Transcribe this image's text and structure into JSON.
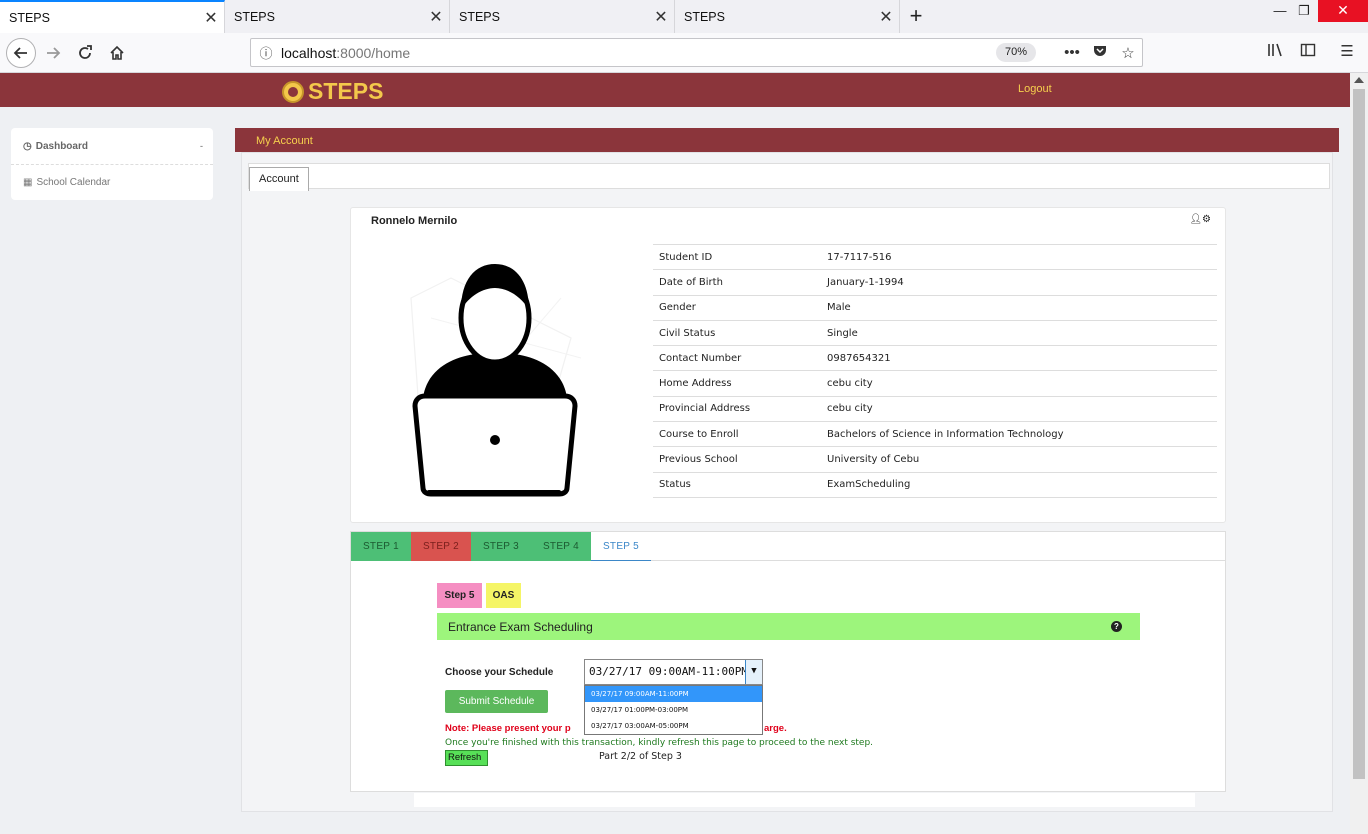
{
  "browser": {
    "tabs": [
      {
        "title": "STEPS"
      },
      {
        "title": "STEPS"
      },
      {
        "title": "STEPS"
      },
      {
        "title": "STEPS"
      }
    ],
    "url_host": "localhost",
    "url_rest": ":8000/home",
    "zoom": "70%"
  },
  "header": {
    "brand": "STEPS",
    "logout": "Logout"
  },
  "sidebar": {
    "items": [
      {
        "label": "Dashboard",
        "icon": "dashboard-icon"
      },
      {
        "label": "School Calendar",
        "icon": "calendar-icon"
      }
    ]
  },
  "account": {
    "header": "My Account",
    "tab": "Account"
  },
  "profile": {
    "name": "Ronnelo Mernilo",
    "fields": [
      {
        "label": "Student ID",
        "value": "17-7117-516"
      },
      {
        "label": "Date of Birth",
        "value": "January-1-1994"
      },
      {
        "label": "Gender",
        "value": "Male"
      },
      {
        "label": "Civil Status",
        "value": "Single"
      },
      {
        "label": "Contact Number",
        "value": "0987654321"
      },
      {
        "label": "Home Address",
        "value": "cebu city"
      },
      {
        "label": "Provincial Address",
        "value": "cebu city"
      },
      {
        "label": "Course to Enroll",
        "value": "Bachelors of Science in Information Technology"
      },
      {
        "label": "Previous School",
        "value": "University of Cebu"
      },
      {
        "label": "Status",
        "value": "ExamScheduling"
      }
    ]
  },
  "steps": {
    "tabs": [
      {
        "label": "STEP 1",
        "state": "done",
        "color": "#4dbf76"
      },
      {
        "label": "STEP 2",
        "state": "failed",
        "color": "#d9534f"
      },
      {
        "label": "STEP 3",
        "state": "done",
        "color": "#4dbf76"
      },
      {
        "label": "STEP 4",
        "state": "done",
        "color": "#4dbf76"
      },
      {
        "label": "STEP 5",
        "state": "current",
        "color": "#3b87c8"
      }
    ],
    "badge_step": "Step 5",
    "badge_oas": "OAS"
  },
  "exam": {
    "title": "Entrance Exam Scheduling",
    "help_icon": "question-circle-icon",
    "schedule_label": "Choose your Schedule",
    "selected": "03/27/17 09:00AM-11:00PM",
    "options": [
      "03/27/17 09:00AM-11:00PM",
      "03/27/17 01:00PM-03:00PM",
      "03/27/17 03:00AM-05:00PM"
    ],
    "submit": "Submit Schedule",
    "note_start": "Note: Please present your p",
    "note_end": "arge.",
    "hint": "Once you're finished with this transaction, kindly refresh this page to proceed to the next step.",
    "refresh": "Refresh",
    "part": "Part 2/2 of Step 3"
  }
}
